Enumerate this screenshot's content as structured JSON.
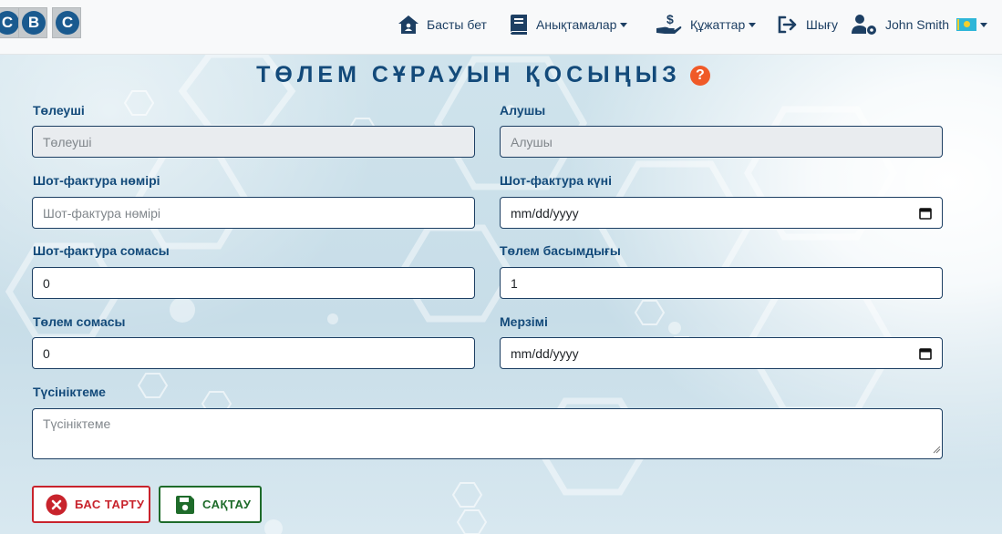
{
  "nav": {
    "logo_letters": [
      "C",
      "B",
      "C"
    ],
    "home": "Басты бет",
    "directories": "Анықтамалар",
    "documents": "Құжаттар",
    "logout": "Шығу",
    "user": "John Smith",
    "language_flag": "kz-flag-icon"
  },
  "page": {
    "title": "ТӨЛЕМ СҰРАУЫН ҚОСЫҢЫЗ",
    "help": "?"
  },
  "form": {
    "payer_label": "Төлеуші",
    "payer_placeholder": "Төлеуші",
    "recipient_label": "Алушы",
    "recipient_placeholder": "Алушы",
    "invoice_number_label": "Шот-фактура нөмірі",
    "invoice_number_placeholder": "Шот-фактура нөмірі",
    "invoice_date_label": "Шот-фактура күні",
    "invoice_date_value": "mm/dd/yyyy",
    "invoice_amount_label": "Шот-фактура сомасы",
    "invoice_amount_value": "0",
    "priority_label": "Төлем басымдығы",
    "priority_value": "1",
    "payment_amount_label": "Төлем сомасы",
    "payment_amount_value": "0",
    "deadline_label": "Мерзімі",
    "deadline_value": "mm/dd/yyyy",
    "comment_label": "Түсініктеме",
    "comment_placeholder": "Түсініктеме"
  },
  "buttons": {
    "cancel": "БАС ТАРТУ",
    "save": "САҚТАУ"
  },
  "colors": {
    "primary": "#134a7a",
    "help_badge": "#f05a28",
    "cancel": "#c8232c",
    "save": "#1e6b2a"
  }
}
